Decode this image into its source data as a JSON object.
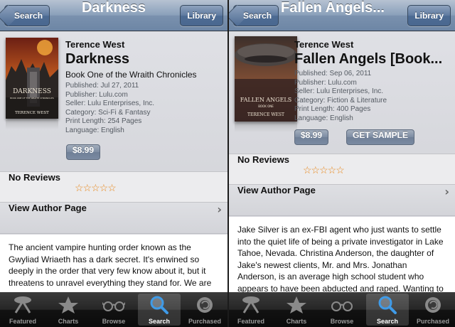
{
  "left": {
    "nav": {
      "back": "Search",
      "title": "Darkness",
      "library": "Library"
    },
    "book": {
      "author": "Terence West",
      "title": "Darkness",
      "subtitle": "Book One of the Wraith Chronicles",
      "published": "Published: Jul 27, 2011",
      "publisher": "Publisher: Lulu.com",
      "seller": "Seller: Lulu Enterprises, Inc.",
      "category": "Category: Sci-Fi & Fantasy",
      "print_length": "Print Length: 254 Pages",
      "language": "Language: English",
      "price": "$8.99",
      "cover_title": "DARKNESS",
      "cover_sub": "BOOK ONE OF THE WRAITH CHRONICLES",
      "cover_author": "TERENCE WEST"
    },
    "reviews": {
      "label": "No Reviews",
      "stars": "☆☆☆☆☆"
    },
    "author_page": "View Author Page",
    "description": "The ancient vampire hunting order known as the Gwyliad Wriaeth has a dark secret. It's enwined so deeply in the order that very few know about it, but it threatens to unravel everything they stand for. We are"
  },
  "right": {
    "nav": {
      "back": "Search",
      "title": "Fallen Angels...",
      "library": "Library"
    },
    "book": {
      "author": "Terence West",
      "title": "Fallen Angels [Book...",
      "published": "Published: Sep 06, 2011",
      "publisher": "Publisher: Lulu.com",
      "seller": "Seller: Lulu Enterprises, Inc.",
      "category": "Category: Fiction & Literature",
      "print_length": "Print Length: 400 Pages",
      "language": "Language: English",
      "price": "$8.99",
      "sample": "GET SAMPLE",
      "cover_title": "FALLEN ANGELS",
      "cover_sub": "BOOK ONE",
      "cover_author": "TERENCE WEST"
    },
    "reviews": {
      "label": "No Reviews",
      "stars": "☆☆☆☆☆"
    },
    "author_page": "View Author Page",
    "description": "Jake Silver is an ex-FBI agent who just wants to settle into the quiet life of being a private investigator in Lake Tahoe, Nevada. Christina Anderson, the daughter of Jake's newest clients, Mr. and Mrs. Jonathan Anderson, is an average high school student who appears to have been abducted and raped. Wanting to"
  },
  "tabs": [
    {
      "label": "Featured",
      "icon": "featured-icon"
    },
    {
      "label": "Charts",
      "icon": "star-icon"
    },
    {
      "label": "Browse",
      "icon": "glasses-icon"
    },
    {
      "label": "Search",
      "icon": "search-icon"
    },
    {
      "label": "Purchased",
      "icon": "purchased-icon"
    }
  ],
  "active_tab": "Search",
  "colors": {
    "star": "#e8871a",
    "nav": "#6d86a5",
    "tab_active": "#ffffff"
  }
}
